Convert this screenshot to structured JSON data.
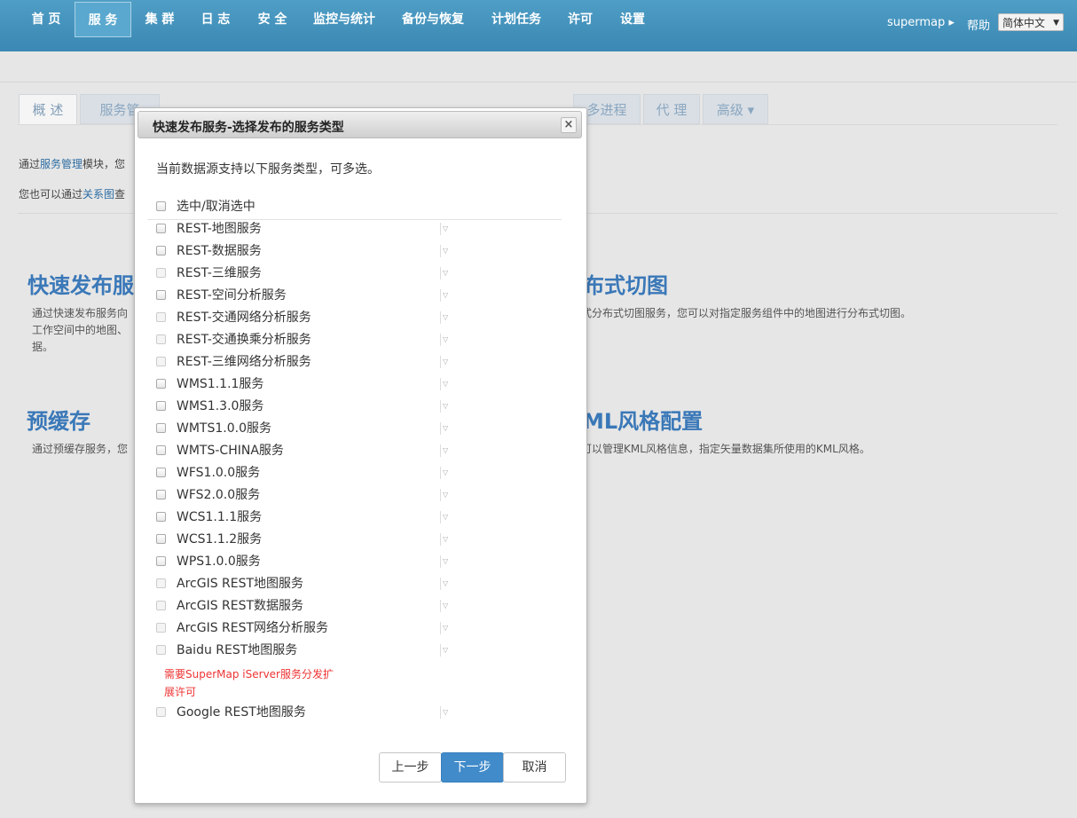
{
  "nav": {
    "items": [
      "首 页",
      "服 务",
      "集 群",
      "日 志",
      "安 全",
      "监控与统计",
      "备份与恢复",
      "计划任务",
      "许可",
      "设置"
    ],
    "user": "supermap ▸",
    "user_caret": "▾",
    "help": "帮助",
    "language": "简体中文",
    "language_caret": "▼"
  },
  "tabs": {
    "items": [
      "概 述",
      "服务管",
      "多进程",
      "代 理",
      "高级 ▾"
    ]
  },
  "intro": {
    "line1_prefix": "通过",
    "line1_link": "服务管理",
    "line1_suffix": "模块，您",
    "line2_prefix": "您也可以通过",
    "line2_link": "关系图",
    "line2_suffix": "查"
  },
  "sections": {
    "quick_publish_title": "快速发布服",
    "quick_publish_desc1": "通过快速发布服务向",
    "quick_publish_desc2": "工作空间中的地图、",
    "quick_publish_desc3": "据。",
    "dist_tile_title": "布式切图",
    "dist_tile_desc": "式分布式切图服务，您可以对指定服务组件中的地图进行分布式切图。",
    "precache_title": "预缓存",
    "precache_desc": "通过预缓存服务，您",
    "kml_title": "ML风格配置",
    "kml_desc": "可以管理KML风格信息，指定矢量数据集所使用的KML风格。"
  },
  "modal": {
    "title": "快速发布服务-选择发布的服务类型",
    "close": "×",
    "description": "当前数据源支持以下服务类型，可多选。",
    "select_all": "选中/取消选中",
    "services": [
      {
        "label": "REST-地图服务",
        "enabled": true
      },
      {
        "label": "REST-数据服务",
        "enabled": true
      },
      {
        "label": "REST-三维服务",
        "enabled": false
      },
      {
        "label": "REST-空间分析服务",
        "enabled": true
      },
      {
        "label": "REST-交通网络分析服务",
        "enabled": false
      },
      {
        "label": "REST-交通换乘分析服务",
        "enabled": false
      },
      {
        "label": "REST-三维网络分析服务",
        "enabled": false
      },
      {
        "label": "WMS1.1.1服务",
        "enabled": true
      },
      {
        "label": "WMS1.3.0服务",
        "enabled": true
      },
      {
        "label": "WMTS1.0.0服务",
        "enabled": true
      },
      {
        "label": "WMTS-CHINA服务",
        "enabled": true
      },
      {
        "label": "WFS1.0.0服务",
        "enabled": true
      },
      {
        "label": "WFS2.0.0服务",
        "enabled": true
      },
      {
        "label": "WCS1.1.1服务",
        "enabled": true
      },
      {
        "label": "WCS1.1.2服务",
        "enabled": true
      },
      {
        "label": "WPS1.0.0服务",
        "enabled": true
      },
      {
        "label": "ArcGIS REST地图服务",
        "enabled": false
      },
      {
        "label": "ArcGIS REST数据服务",
        "enabled": false
      },
      {
        "label": "ArcGIS REST网络分析服务",
        "enabled": false
      },
      {
        "label": "Baidu REST地图服务",
        "enabled": false
      }
    ],
    "baidu_note": "需要SuperMap iServer服务分发扩展许可",
    "google": {
      "label": "Google REST地图服务",
      "enabled": false
    },
    "buttons": {
      "prev": "上一步",
      "next": "下一步",
      "cancel": "取消"
    }
  }
}
